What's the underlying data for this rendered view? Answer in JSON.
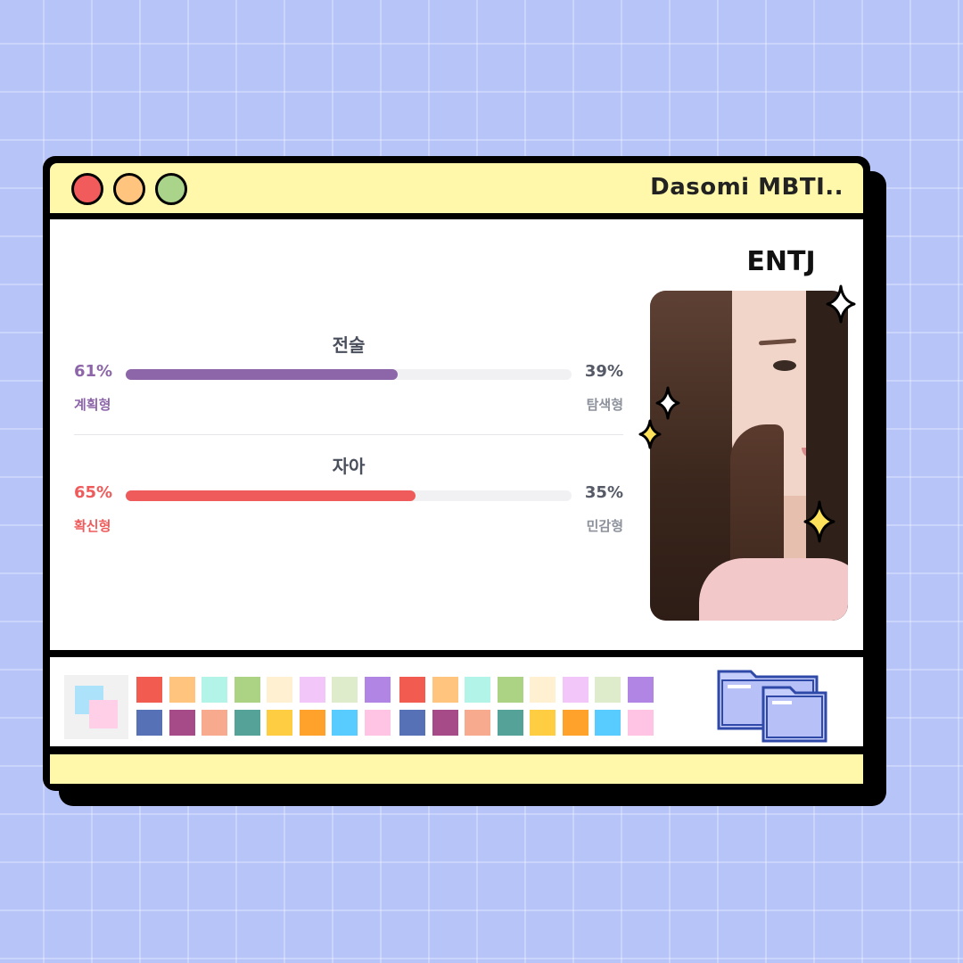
{
  "window": {
    "title": "Dasomi MBTI..",
    "buttons": [
      "close",
      "minimize",
      "maximize"
    ]
  },
  "profile": {
    "mbti_type": "ENTJ"
  },
  "stats": [
    {
      "category": "전술",
      "left_percent": "61%",
      "right_percent": "39%",
      "left_label": "계획형",
      "right_label": "탐색형",
      "value": 0.61,
      "color": "#8c66a8"
    },
    {
      "category": "자아",
      "left_percent": "65%",
      "right_percent": "35%",
      "left_label": "확신형",
      "right_label": "민감형",
      "value": 0.65,
      "color": "#ef5b5b"
    }
  ],
  "palette": {
    "row1": [
      "#f25b50",
      "#ffc57e",
      "#b2f5e8",
      "#acd384",
      "#fff0d2",
      "#f3c6fa",
      "#deeccb",
      "#b085e3",
      "#f25b50",
      "#ffc57e",
      "#b2f5e8",
      "#acd384",
      "#fff0d2",
      "#f3c6fa",
      "#deeccb",
      "#b085e3"
    ],
    "row2": [
      "#5671b5",
      "#a64b88",
      "#f8aa8f",
      "#55a398",
      "#ffcd42",
      "#ffa22b",
      "#58cbff",
      "#ffc3e4",
      "#5671b5",
      "#a64b88",
      "#f8aa8f",
      "#55a398",
      "#ffcd42",
      "#ffa22b",
      "#58cbff",
      "#ffc3e4"
    ]
  },
  "icons": {
    "palette": "palette-icon",
    "folders": "folder-icon",
    "sparkle": "sparkle-icon"
  }
}
